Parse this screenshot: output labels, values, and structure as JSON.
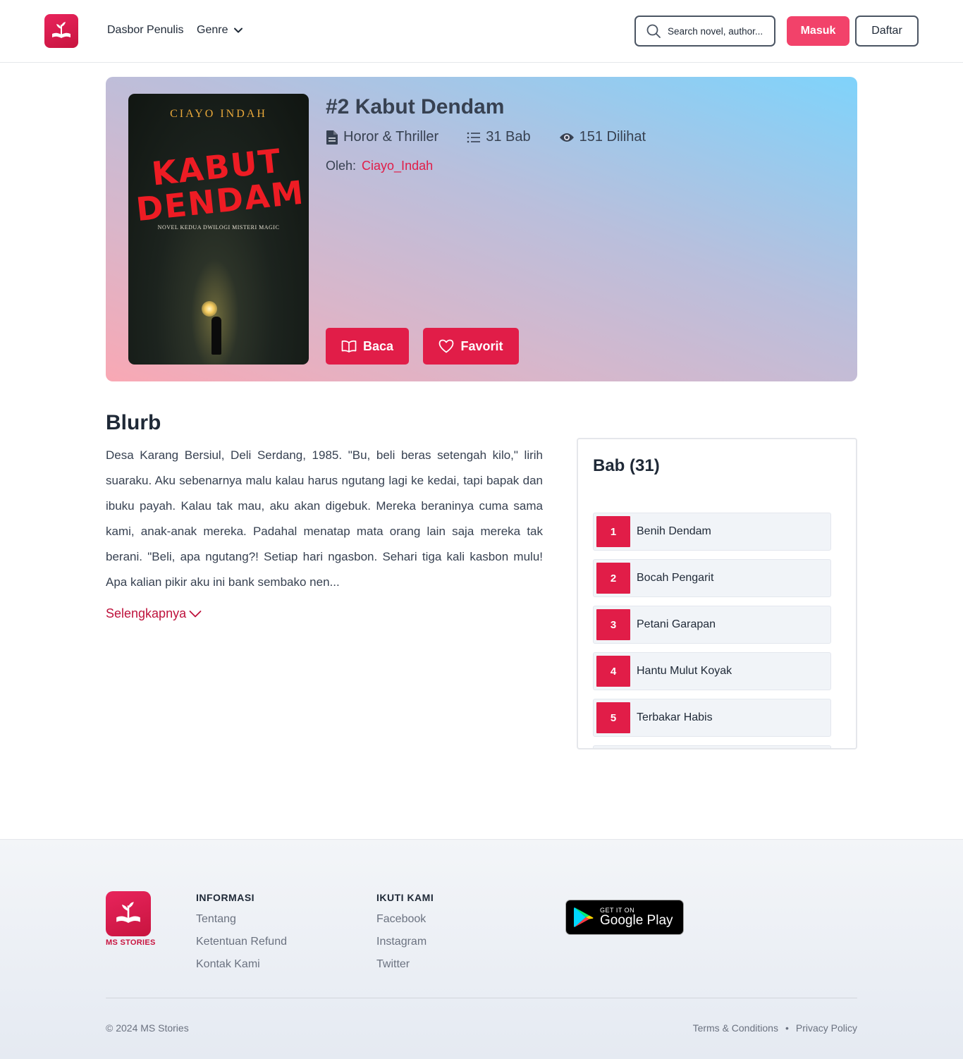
{
  "header": {
    "nav": {
      "dashboard_label": "Dasbor Penulis",
      "genre_label": "Genre"
    },
    "search": {
      "placeholder": "Search novel, author..."
    },
    "login_label": "Masuk",
    "register_label": "Daftar"
  },
  "book": {
    "title": "#2 Kabut Dendam",
    "genre": "Horor & Thriller",
    "chapters_count": "31 Bab",
    "views": "151 Dilihat",
    "author_label": "Oleh:",
    "author_name": "Ciayo_Indah",
    "cover": {
      "author_text": "CIAYO INDAH",
      "title_line1": "KABUT",
      "title_line2": "DENDAM",
      "subtitle": "NOVEL KEDUA DWILOGI MISTERI MAGIC"
    },
    "read_label": "Baca",
    "favorite_label": "Favorit"
  },
  "blurb": {
    "heading": "Blurb",
    "text": "Desa Karang Bersiul, Deli Serdang, 1985. \"Bu, beli beras setengah kilo,\" lirih suaraku. Aku sebenarnya malu kalau harus ngutang lagi ke kedai, tapi bapak dan ibuku payah. Kalau tak mau, aku akan digebuk. Mereka beraninya cuma sama kami, anak-anak mereka. Padahal menatap mata orang lain saja mereka tak berani. \"Beli, apa ngutang?! Setiap hari ngasbon. Sehari tiga kali kasbon mulu! Apa kalian pikir aku ini bank sembako nen...",
    "more_label": "Selengkapnya"
  },
  "chapters": {
    "heading": "Bab (31)",
    "items": [
      {
        "num": "1",
        "title": "Benih Dendam"
      },
      {
        "num": "2",
        "title": "Bocah Pengarit"
      },
      {
        "num": "3",
        "title": "Petani Garapan"
      },
      {
        "num": "4",
        "title": "Hantu Mulut Koyak"
      },
      {
        "num": "5",
        "title": "Terbakar Habis"
      },
      {
        "num": "",
        "title": ""
      }
    ]
  },
  "footer": {
    "brand": "MS STORIES",
    "info": {
      "heading": "INFORMASI",
      "links": [
        "Tentang",
        "Ketentuan Refund",
        "Kontak Kami"
      ]
    },
    "follow": {
      "heading": "IKUTI KAMI",
      "links": [
        "Facebook",
        "Instagram",
        "Twitter"
      ]
    },
    "gplay": {
      "small": "GET IT ON",
      "big": "Google Play"
    },
    "copyright": "© 2024 MS Stories",
    "terms": "Terms & Conditions",
    "separator": "•",
    "privacy": "Privacy Policy"
  },
  "colors": {
    "accent": "#e11d48",
    "login_button": "#f2426a",
    "text_dark": "#1f2937"
  },
  "icons": [
    "logo-icon",
    "chevron-down-icon",
    "search-icon",
    "document-icon",
    "list-icon",
    "eye-icon",
    "book-open-icon",
    "heart-icon",
    "google-play-icon"
  ]
}
